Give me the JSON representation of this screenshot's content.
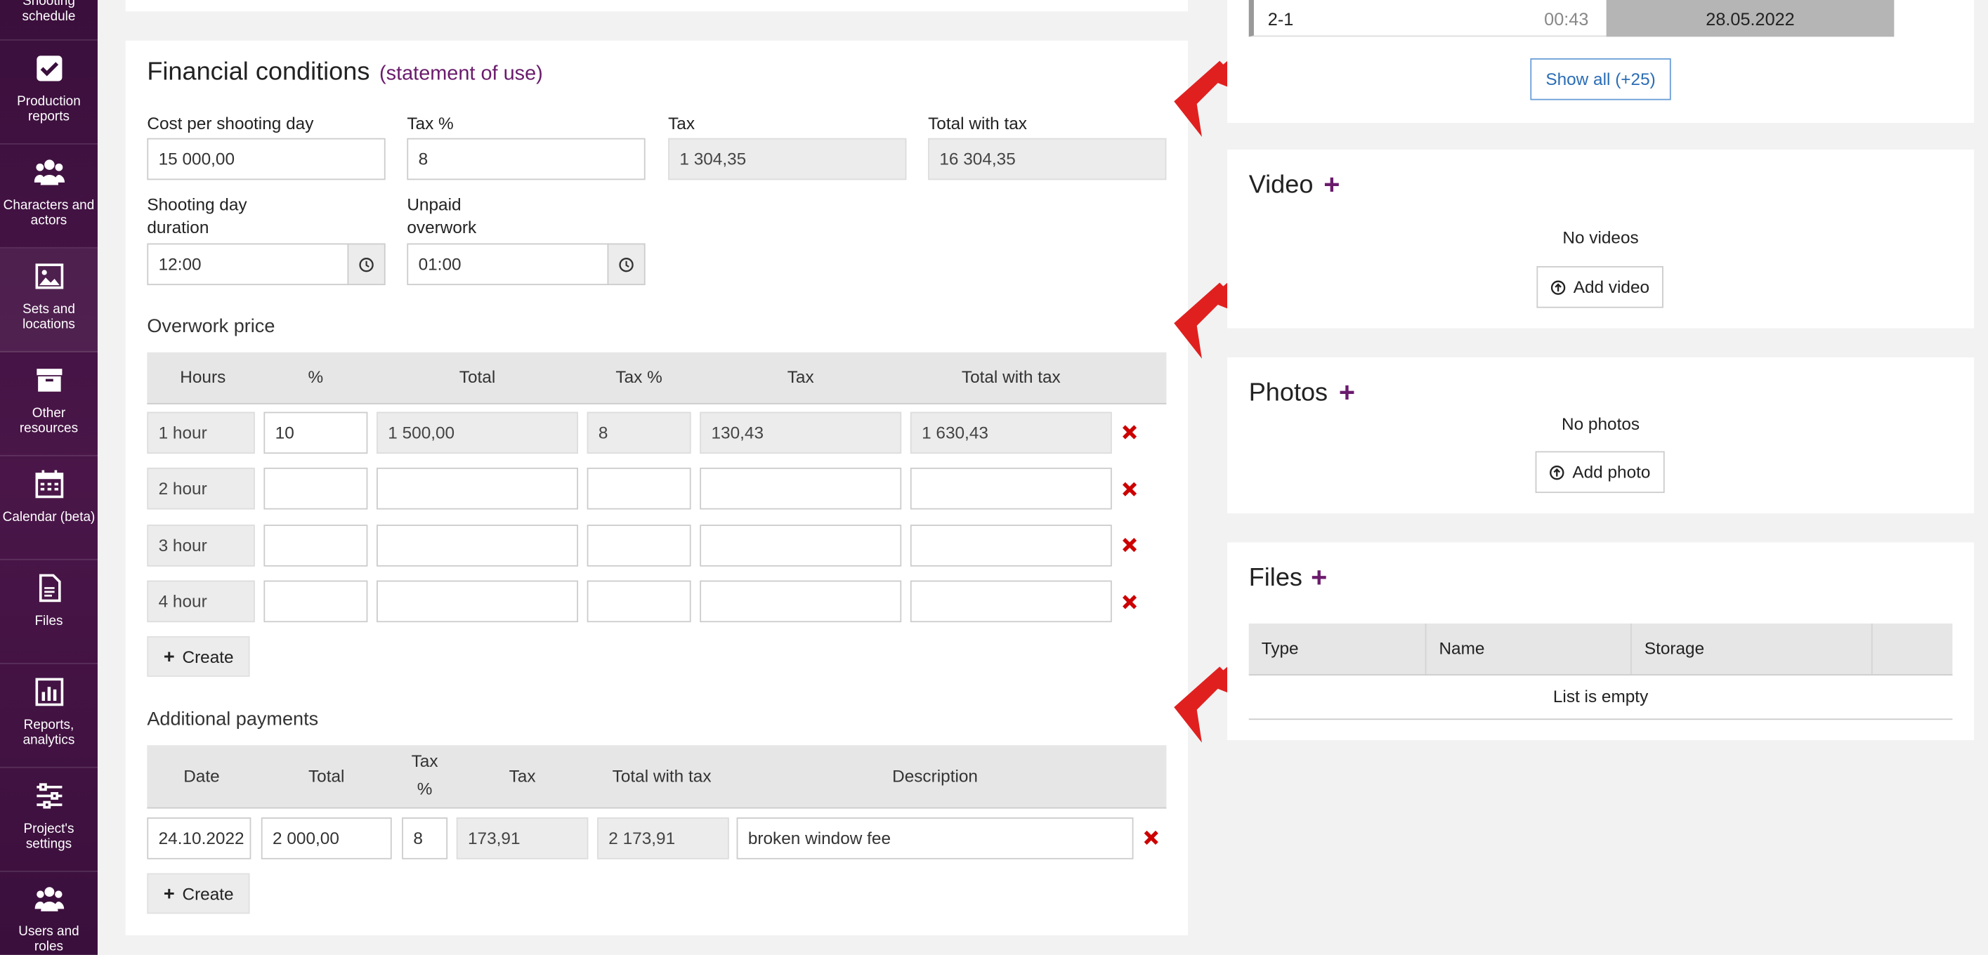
{
  "sidebar": {
    "items": [
      {
        "label": "Shooting schedule",
        "icon": "schedule-icon"
      },
      {
        "label": "Production reports",
        "icon": "checkbox-icon"
      },
      {
        "label": "Characters and actors",
        "icon": "people-icon"
      },
      {
        "label": "Sets and locations",
        "icon": "image-icon"
      },
      {
        "label": "Other resources",
        "icon": "archive-icon"
      },
      {
        "label": "Calendar (beta)",
        "icon": "calendar-icon"
      },
      {
        "label": "Files",
        "icon": "file-icon"
      },
      {
        "label": "Reports, analytics",
        "icon": "chart-icon"
      },
      {
        "label": "Project's settings",
        "icon": "sliders-icon"
      },
      {
        "label": "Users and roles",
        "icon": "users-icon"
      }
    ]
  },
  "financial": {
    "title": "Financial conditions",
    "statement_link": "(statement of use)",
    "cost_label": "Cost per shooting day",
    "cost_value": "15 000,00",
    "taxpct_label": "Tax %",
    "taxpct_value": "8",
    "tax_label": "Tax",
    "tax_value": "1 304,35",
    "total_label": "Total with tax",
    "total_value": "16 304,35",
    "duration_label_1": "Shooting day",
    "duration_label_2": "duration",
    "duration_value": "12:00",
    "unpaid_label_1": "Unpaid",
    "unpaid_label_2": "overwork",
    "unpaid_value": "01:00"
  },
  "overwork": {
    "title": "Overwork price",
    "headers": [
      "Hours",
      "%",
      "Total",
      "Tax %",
      "Tax",
      "Total with tax"
    ],
    "rows": [
      {
        "hours": "1 hour",
        "pct": "10",
        "total": "1 500,00",
        "taxpct": "8",
        "tax": "130,43",
        "total_tax": "1 630,43"
      },
      {
        "hours": "2 hour",
        "pct": "",
        "total": "",
        "taxpct": "",
        "tax": "",
        "total_tax": ""
      },
      {
        "hours": "3 hour",
        "pct": "",
        "total": "",
        "taxpct": "",
        "tax": "",
        "total_tax": ""
      },
      {
        "hours": "4 hour",
        "pct": "",
        "total": "",
        "taxpct": "",
        "tax": "",
        "total_tax": ""
      }
    ],
    "create_label": "Create"
  },
  "additional": {
    "title": "Additional payments",
    "headers": [
      "Date",
      "Total",
      "Tax",
      "%",
      "Tax",
      "Total with tax",
      "Description"
    ],
    "row": {
      "date": "24.10.2022",
      "total": "2 000,00",
      "taxpct": "8",
      "tax": "173,91",
      "total_tax": "2 173,91",
      "description": "broken window fee"
    },
    "create_label": "Create"
  },
  "schedule_card": {
    "row_code": "2-1",
    "row_time": "00:43",
    "row_date": "28.05.2022",
    "show_all": "Show all (+25)"
  },
  "video": {
    "title": "Video",
    "empty": "No videos",
    "add_label": "Add video"
  },
  "photos": {
    "title": "Photos",
    "empty": "No photos",
    "add_label": "Add photo"
  },
  "files": {
    "title": "Files",
    "headers": [
      "Type",
      "Name",
      "Storage"
    ],
    "empty": "List is empty"
  },
  "colors": {
    "accent": "#6a1b6c",
    "delete": "#cc0000",
    "arrow": "#e0201f",
    "sidebar": "#3a0f3c"
  }
}
